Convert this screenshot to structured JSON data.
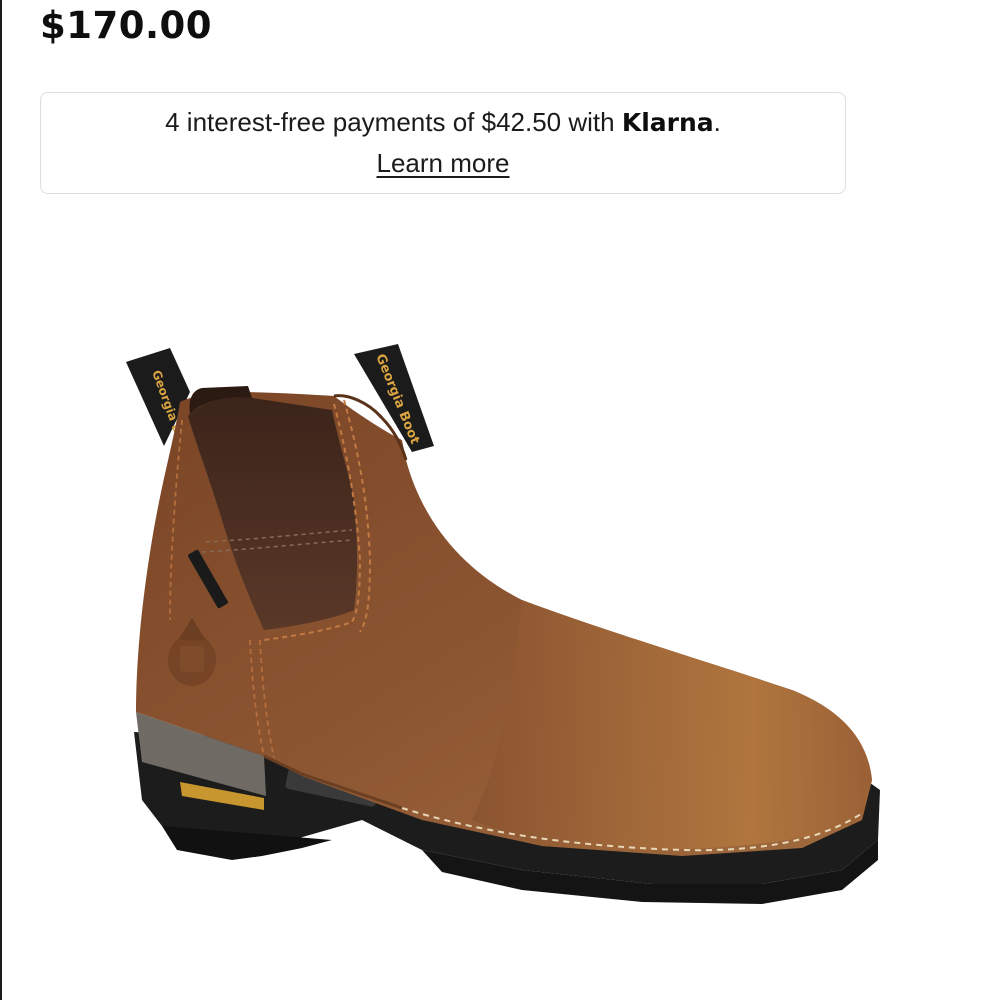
{
  "product": {
    "price": "$170.00",
    "image_name": "brown-pull-on-work-boot"
  },
  "klarna": {
    "prefix": "4 interest-free payments of $42.50 with ",
    "brand": "Klarna",
    "suffix": ".",
    "link": "Learn more"
  },
  "boot_pull_tab_text": "Georgia Boot",
  "colors": {
    "price_text": "#0e0e0e",
    "box_border": "#dedede",
    "leather": "#8a5230",
    "elastic_gore": "#4a2e22",
    "sole": "#1c1c1c"
  }
}
